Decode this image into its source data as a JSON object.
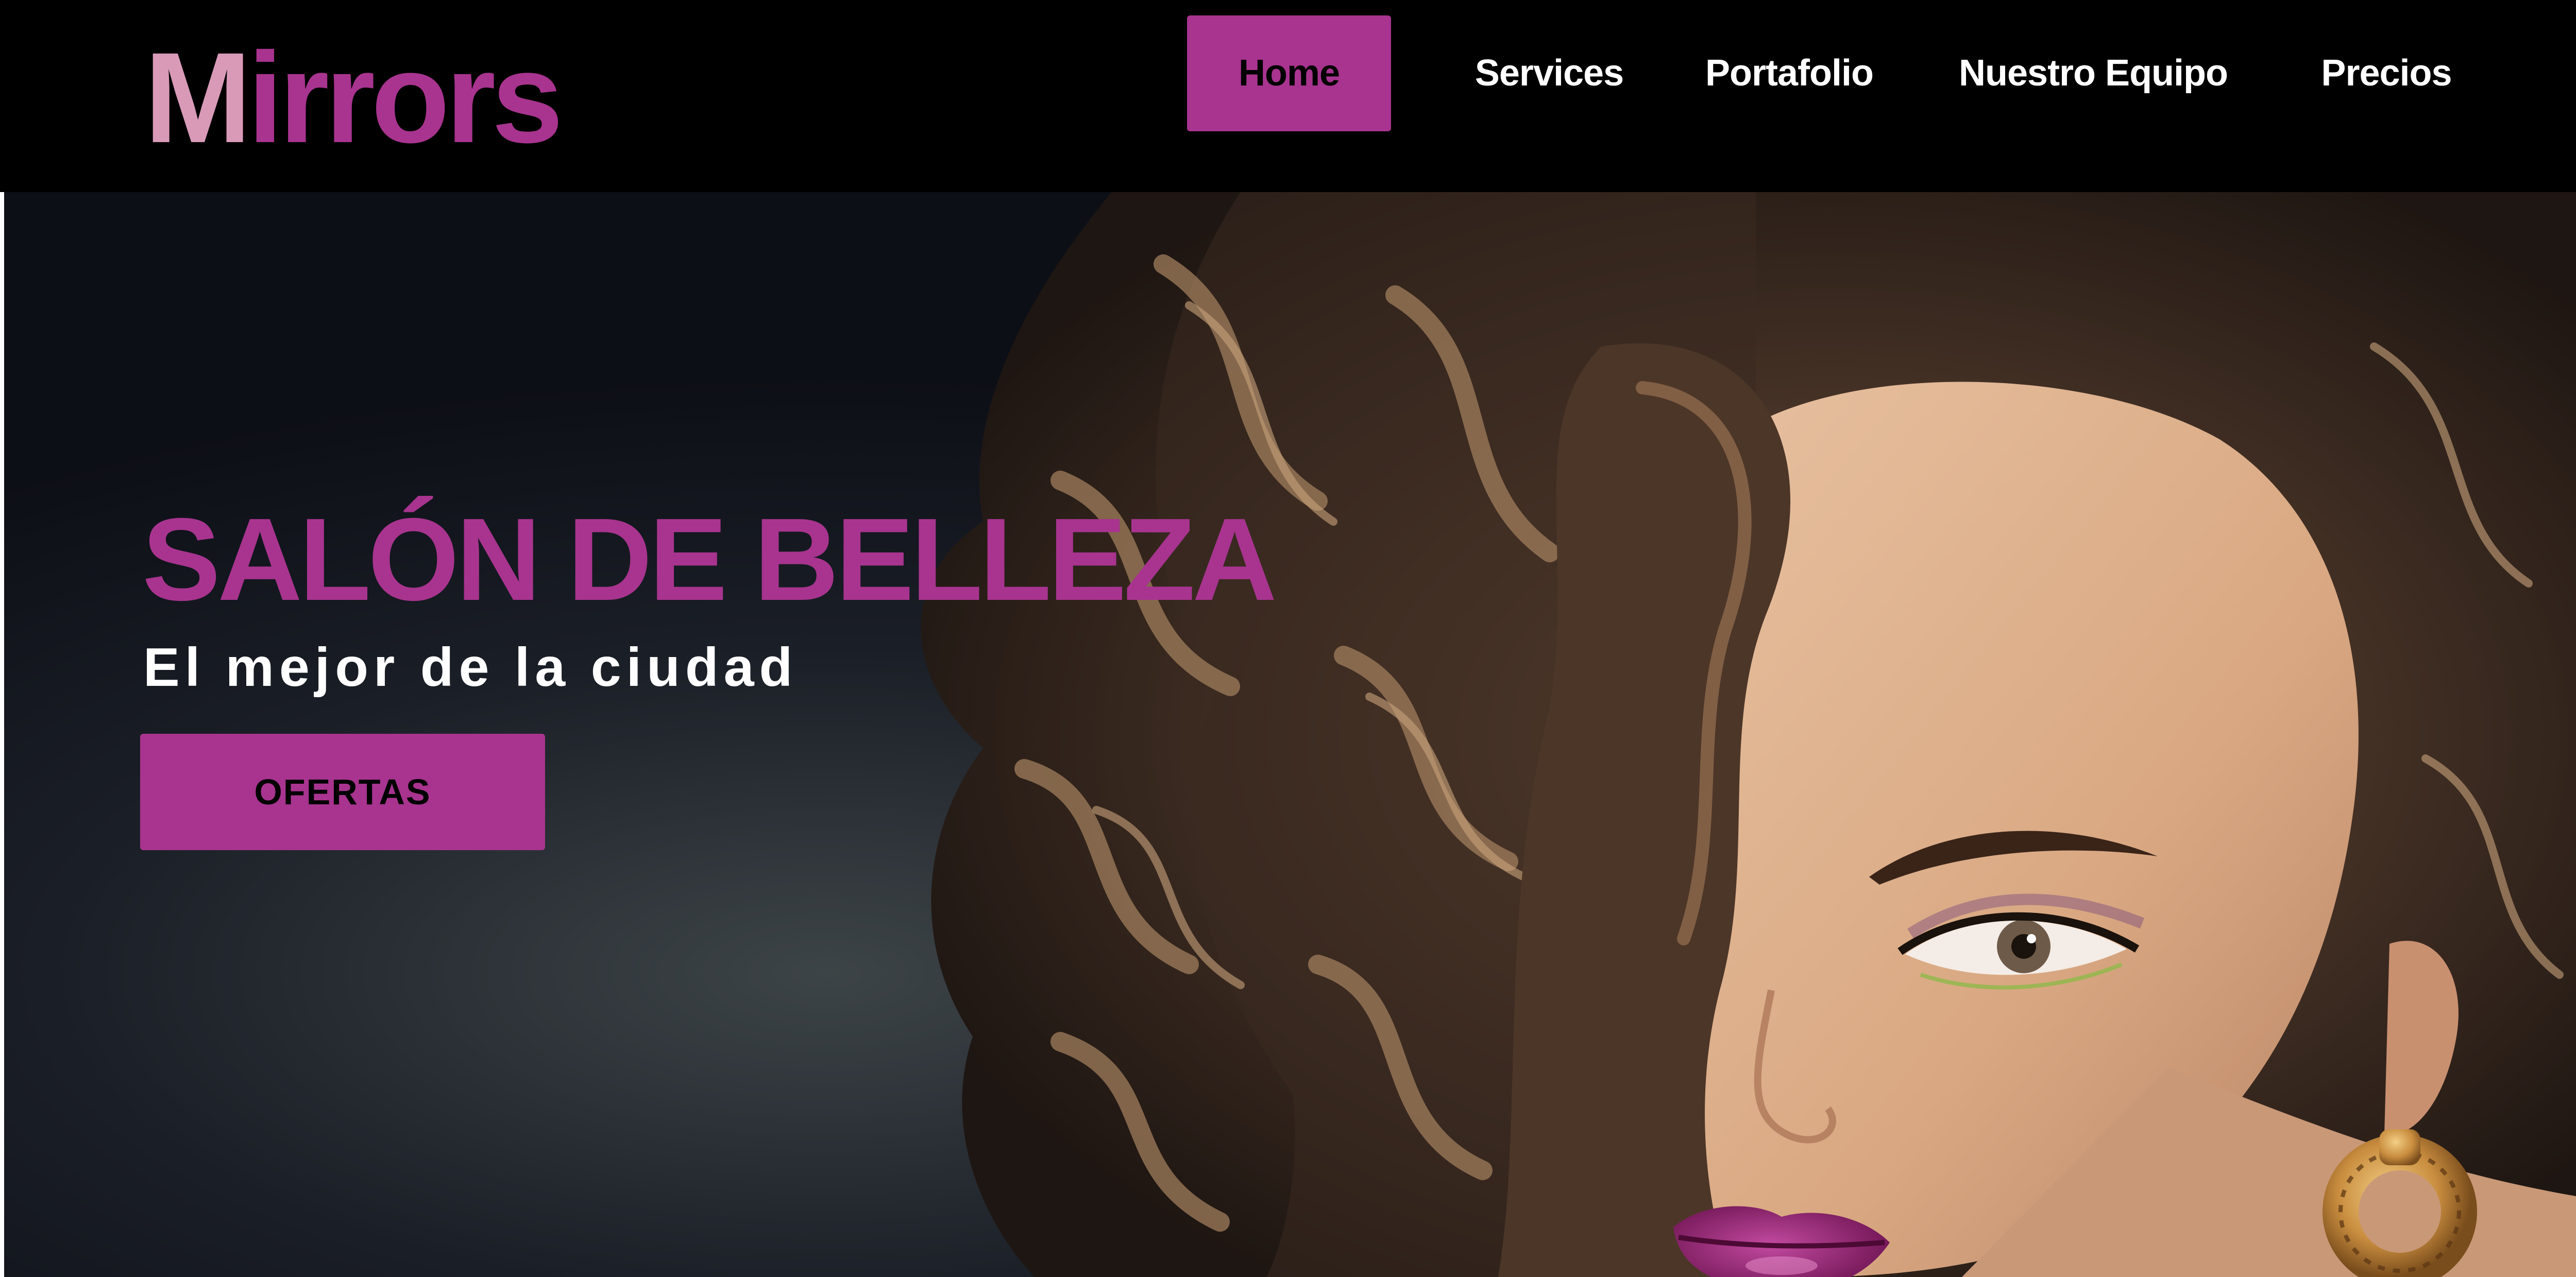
{
  "brand": {
    "logo_first_letter": "M",
    "logo_rest": "irrors",
    "logo_first_color": "#d99ab8",
    "accent_color": "#a8348f"
  },
  "nav": {
    "items": [
      {
        "label": "Home",
        "active": true
      },
      {
        "label": "Services",
        "active": false
      },
      {
        "label": "Portafolio",
        "active": false
      },
      {
        "label": "Nuestro Equipo",
        "active": false
      },
      {
        "label": "Precios",
        "active": false
      }
    ]
  },
  "hero": {
    "title": "SALÓN DE BELLEZA",
    "subtitle": "El mejor de la ciudad",
    "button_label": "OFERTAS",
    "image": "woman-with-wavy-hair-portrait"
  }
}
